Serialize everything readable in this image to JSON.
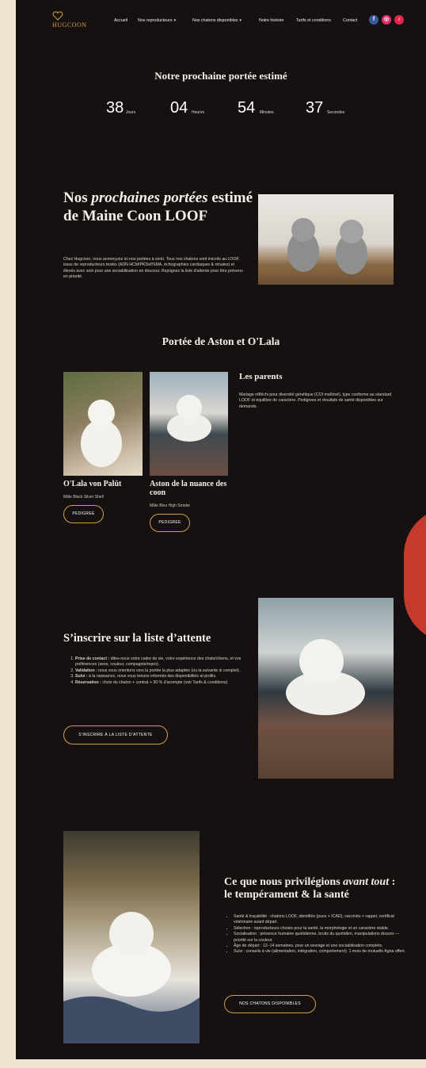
{
  "header": {
    "logo_text": "HUGCOON",
    "nav": [
      "Accueil",
      "Nos reproducteurs",
      "Nos chatons disponibles",
      "Notre histoire",
      "Tarifs et conditions",
      "Contact"
    ],
    "social": [
      "facebook-icon",
      "instagram-icon",
      "tiktok-icon"
    ],
    "colors": {
      "gold": "#c9a24a",
      "background": "#161110",
      "accent": "#c43b2d",
      "facebook": "#3b5998",
      "instagram": "#e1306c",
      "tiktok": "#e5254a"
    }
  },
  "countdown": {
    "title": "Notre prochaine portée estimé",
    "days": "38",
    "days_label": "Jours",
    "hours": "04",
    "hours_label": "Heures",
    "minutes": "54",
    "minutes_label": "Minutes",
    "seconds": "37",
    "seconds_label": "Secondes"
  },
  "next": {
    "title_pre": "Nos ",
    "title_em": "prochaines portées",
    "title_post": " estimé de Maine Coon LOOF",
    "body": "Chez Hugcoon, nous annonçons ici nos portées à venir. Tous nos chatons sont inscrits au LOOF, issus de reproducteurs testés (ADN HCM/PKDef/SMA, échographies cardiaques & rénales) et élevés avec soin pour une sociabilisation en douceur. Rejoignez la liste d'attente pour être prévenu en priorité."
  },
  "litter": {
    "title": "Portée de Aston et O'Lala",
    "parents_title": "Les parents",
    "parents_text": "Mariage réfléchi pour diversité génétique (COI maîtrisé), type conforme au standard LOOF et équilibre de caractère. Pedigrees et résultats de santé disponibles sur demande.",
    "mother_name": "O'Lala von Palüt",
    "mother_desc": "Mâle Black Silver Shell",
    "father_name": "Aston de la nuance des coon",
    "father_desc": "Mâle Bleu High Smoke",
    "pedigree_label": "PEDIGREE"
  },
  "waitlist": {
    "title": "S’inscrire sur la liste d’attente",
    "steps": [
      {
        "bold": "Prise de contact :",
        "text": " dites-nous votre cadre de vie, votre expérience des chats/chiens, et vos préférences (sexe, couleur, compagnie/repro)."
      },
      {
        "bold": "Validation :",
        "text": " nous vous orientons vers la portée la plus adaptée (ou la suivante si complet)."
      },
      {
        "bold": "Suivi :",
        "text": " à la naissance, nous vous tenons informés des disponibilités et profils."
      },
      {
        "bold": "Réservation :",
        "text": " choix du chaton + contrat + 30 % d’acompte (voir Tarifs & conditions)."
      }
    ],
    "button": "S’INSCRIRE À LA LISTE D’ATTENTE"
  },
  "priorities": {
    "title_pre": "Ce que nous privilégions ",
    "title_em": "avant tout",
    "title_post": " : le tempérament & la santé",
    "bullets": [
      "Santé & traçabilité : chatons LOOF, identifiés (puce + ICAD), vaccinés + rappel, certificat vétérinaire avant départ.",
      "Sélection : reproducteurs choisis pour la santé, la morphologie et un caractère stable.",
      "Socialisation : présence humaine quotidienne, bruits du quotidien, manipulations douces — priorité sur la couleur.",
      "Âge de départ : 12–14 semaines, pour un sevrage et une sociabilisation complets.",
      "Suivi : conseils à vie (alimentation, intégration, comportement). 1 mois de mutuelle Agria offert."
    ],
    "button": "NOS CHATONS DISPONIBLES"
  }
}
